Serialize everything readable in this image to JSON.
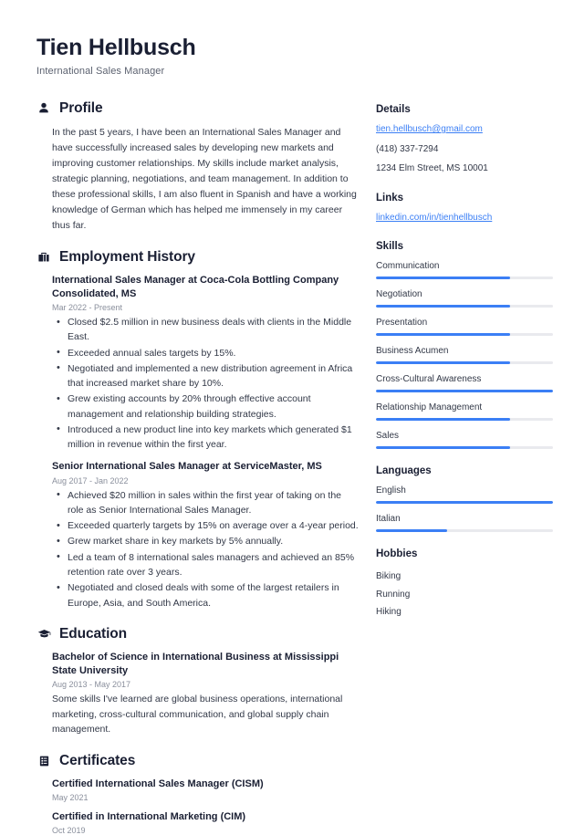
{
  "header": {
    "name": "Tien Hellbusch",
    "title": "International Sales Manager"
  },
  "sections": {
    "profile": {
      "icon": "user-icon",
      "title": "Profile",
      "text": "In the past 5 years, I have been an International Sales Manager and have successfully increased sales by developing new markets and improving customer relationships. My skills include market analysis, strategic planning, negotiations, and team management. In addition to these professional skills, I am also fluent in Spanish and have a working knowledge of German which has helped me immensely in my career thus far."
    },
    "employment": {
      "icon": "briefcase-icon",
      "title": "Employment History",
      "entries": [
        {
          "title": "International Sales Manager at Coca-Cola Bottling Company Consolidated, MS",
          "date": "Mar 2022 - Present",
          "bullets": [
            "Closed $2.5 million in new business deals with clients in the Middle East.",
            "Exceeded annual sales targets by 15%.",
            "Negotiated and implemented a new distribution agreement in Africa that increased market share by 10%.",
            "Grew existing accounts by 20% through effective account management and relationship building strategies.",
            "Introduced a new product line into key markets which generated $1 million in revenue within the first year."
          ]
        },
        {
          "title": "Senior International Sales Manager at ServiceMaster, MS",
          "date": "Aug 2017 - Jan 2022",
          "bullets": [
            "Achieved $20 million in sales within the first year of taking on the role as Senior International Sales Manager.",
            "Exceeded quarterly targets by 15% on average over a 4-year period.",
            "Grew market share in key markets by 5% annually.",
            "Led a team of 8 international sales managers and achieved an 85% retention rate over 3 years.",
            "Negotiated and closed deals with some of the largest retailers in Europe, Asia, and South America."
          ]
        }
      ]
    },
    "education": {
      "icon": "graduation-cap-icon",
      "title": "Education",
      "entries": [
        {
          "title": "Bachelor of Science in International Business at Mississippi State University",
          "date": "Aug 2013 - May 2017",
          "description": "Some skills I've learned are global business operations, international marketing, cross-cultural communication, and global supply chain management."
        }
      ]
    },
    "certificates": {
      "icon": "clipboard-icon",
      "title": "Certificates",
      "entries": [
        {
          "title": "Certified International Sales Manager (CISM)",
          "date": "May 2021"
        },
        {
          "title": "Certified in International Marketing (CIM)",
          "date": "Oct 2019"
        }
      ]
    }
  },
  "sidebar": {
    "details": {
      "title": "Details",
      "email": "tien.hellbusch@gmail.com",
      "phone": "(418) 337-7294",
      "address": "1234 Elm Street, MS 10001"
    },
    "links": {
      "title": "Links",
      "items": [
        {
          "label": "linkedin.com/in/tienhellbusch"
        }
      ]
    },
    "skills": {
      "title": "Skills",
      "items": [
        {
          "label": "Communication",
          "level": 76
        },
        {
          "label": "Negotiation",
          "level": 76
        },
        {
          "label": "Presentation",
          "level": 76
        },
        {
          "label": "Business Acumen",
          "level": 76
        },
        {
          "label": "Cross-Cultural Awareness",
          "level": 100
        },
        {
          "label": "Relationship Management",
          "level": 76
        },
        {
          "label": "Sales",
          "level": 76
        }
      ]
    },
    "languages": {
      "title": "Languages",
      "items": [
        {
          "label": "English",
          "level": 100
        },
        {
          "label": "Italian",
          "level": 40
        }
      ]
    },
    "hobbies": {
      "title": "Hobbies",
      "items": [
        {
          "label": "Biking"
        },
        {
          "label": "Running"
        },
        {
          "label": "Hiking"
        }
      ]
    }
  },
  "colors": {
    "accent": "#3b7ff5",
    "text": "#323847",
    "heading": "#1a1f33",
    "muted": "#8a8f9c",
    "track": "#e9eaee"
  }
}
